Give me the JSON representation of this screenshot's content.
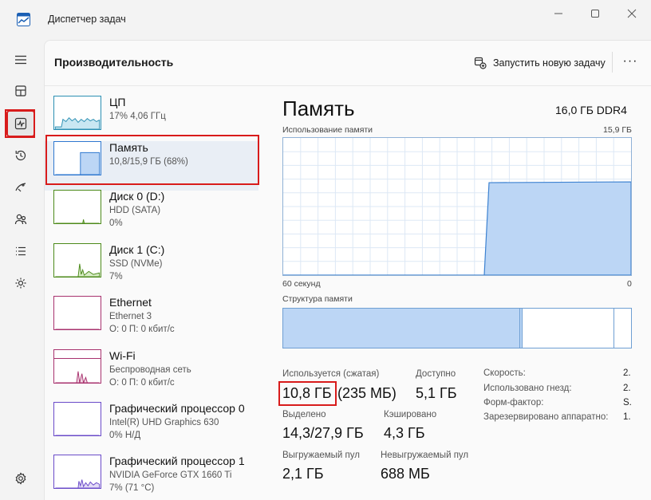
{
  "window": {
    "title": "Диспетчер задач",
    "controls": [
      "minimize-icon",
      "maximize-icon",
      "close-icon"
    ]
  },
  "sidebar": {
    "items": [
      {
        "icon": "hamburger-icon",
        "name": "menu"
      },
      {
        "icon": "processes-icon",
        "name": "processes"
      },
      {
        "icon": "performance-icon",
        "name": "performance",
        "active": true
      },
      {
        "icon": "history-icon",
        "name": "app-history"
      },
      {
        "icon": "startup-icon",
        "name": "startup-apps"
      },
      {
        "icon": "users-icon",
        "name": "users"
      },
      {
        "icon": "details-icon",
        "name": "details"
      },
      {
        "icon": "services-icon",
        "name": "services"
      },
      {
        "icon": "settings-icon",
        "name": "settings"
      }
    ]
  },
  "header": {
    "title": "Производительность",
    "run_task_label": "Запустить новую задачу",
    "more_label": "···"
  },
  "devices": [
    {
      "name": "ЦП",
      "sub1": "17% 4,06 ГГц",
      "sub2": "",
      "graph_color": "#2b8fb3",
      "fill": "#c9e7f2"
    },
    {
      "name": "Память",
      "sub1": "10,8/15,9 ГБ (68%)",
      "sub2": "",
      "graph_color": "#2f78d0",
      "fill": "#bcd6f5",
      "selected": true
    },
    {
      "name": "Диск 0 (D:)",
      "sub1": "HDD (SATA)",
      "sub2": "0%",
      "graph_color": "#4c8a1a",
      "fill": "#d8ecc6"
    },
    {
      "name": "Диск 1 (C:)",
      "sub1": "SSD (NVMe)",
      "sub2": "7%",
      "graph_color": "#4c8a1a",
      "fill": "#d8ecc6"
    },
    {
      "name": "Ethernet",
      "sub1": "Ethernet 3",
      "sub2": "О: 0 П: 0 кбит/с",
      "graph_color": "#a8326e",
      "fill": "#f3dbe7"
    },
    {
      "name": "Wi-Fi",
      "sub1": "Беспроводная сеть",
      "sub2": "О: 0 П: 0 кбит/с",
      "graph_color": "#a8326e",
      "fill": "#f3dbe7"
    },
    {
      "name": "Графический процессор 0",
      "sub1": "Intel(R) UHD Graphics 630",
      "sub2": "0% Н/Д",
      "graph_color": "#6a4bc9",
      "fill": "#e3dcf6"
    },
    {
      "name": "Графический процессор 1",
      "sub1": "NVIDIA GeForce GTX 1660 Ti",
      "sub2": "7% (71 °C)",
      "graph_color": "#6a4bc9",
      "fill": "#e3dcf6"
    }
  ],
  "memory": {
    "title": "Память",
    "capacity": "16,0 ГБ DDR4",
    "usage_label": "Использование памяти",
    "usage_max": "15,9 ГБ",
    "time_label": "60 секунд",
    "time_end": "0",
    "structure_label": "Структура памяти",
    "usage_level_fraction": 0.68,
    "structure_segments": [
      {
        "name": "in-use",
        "fraction": 0.68,
        "color": "#bcd6f5"
      },
      {
        "name": "modified",
        "fraction": 0.005,
        "color": "#bcd6f5"
      },
      {
        "name": "standby",
        "fraction": 0.265,
        "color": "#ffffff"
      },
      {
        "name": "free",
        "fraction": 0.05,
        "color": "#ffffff"
      }
    ],
    "stats": {
      "in_use_label": "Используется (сжатая)",
      "in_use_value": "10,8 ГБ",
      "in_use_compressed": "(235 МБ)",
      "available_label": "Доступно",
      "available_value": "5,1 ГБ",
      "committed_label": "Выделено",
      "committed_value": "14,3/27,9 ГБ",
      "cached_label": "Кэшировано",
      "cached_value": "4,3 ГБ",
      "paged_label": "Выгружаемый пул",
      "paged_value": "2,1 ГБ",
      "nonpaged_label": "Невыгружаемый пул",
      "nonpaged_value": "688 МБ"
    },
    "details": [
      {
        "label": "Скорость:",
        "value": "2."
      },
      {
        "label": "Использовано гнезд:",
        "value": "2."
      },
      {
        "label": "Форм-фактор:",
        "value": "S."
      },
      {
        "label": "Зарезервировано аппаратно:",
        "value": "1."
      }
    ]
  }
}
